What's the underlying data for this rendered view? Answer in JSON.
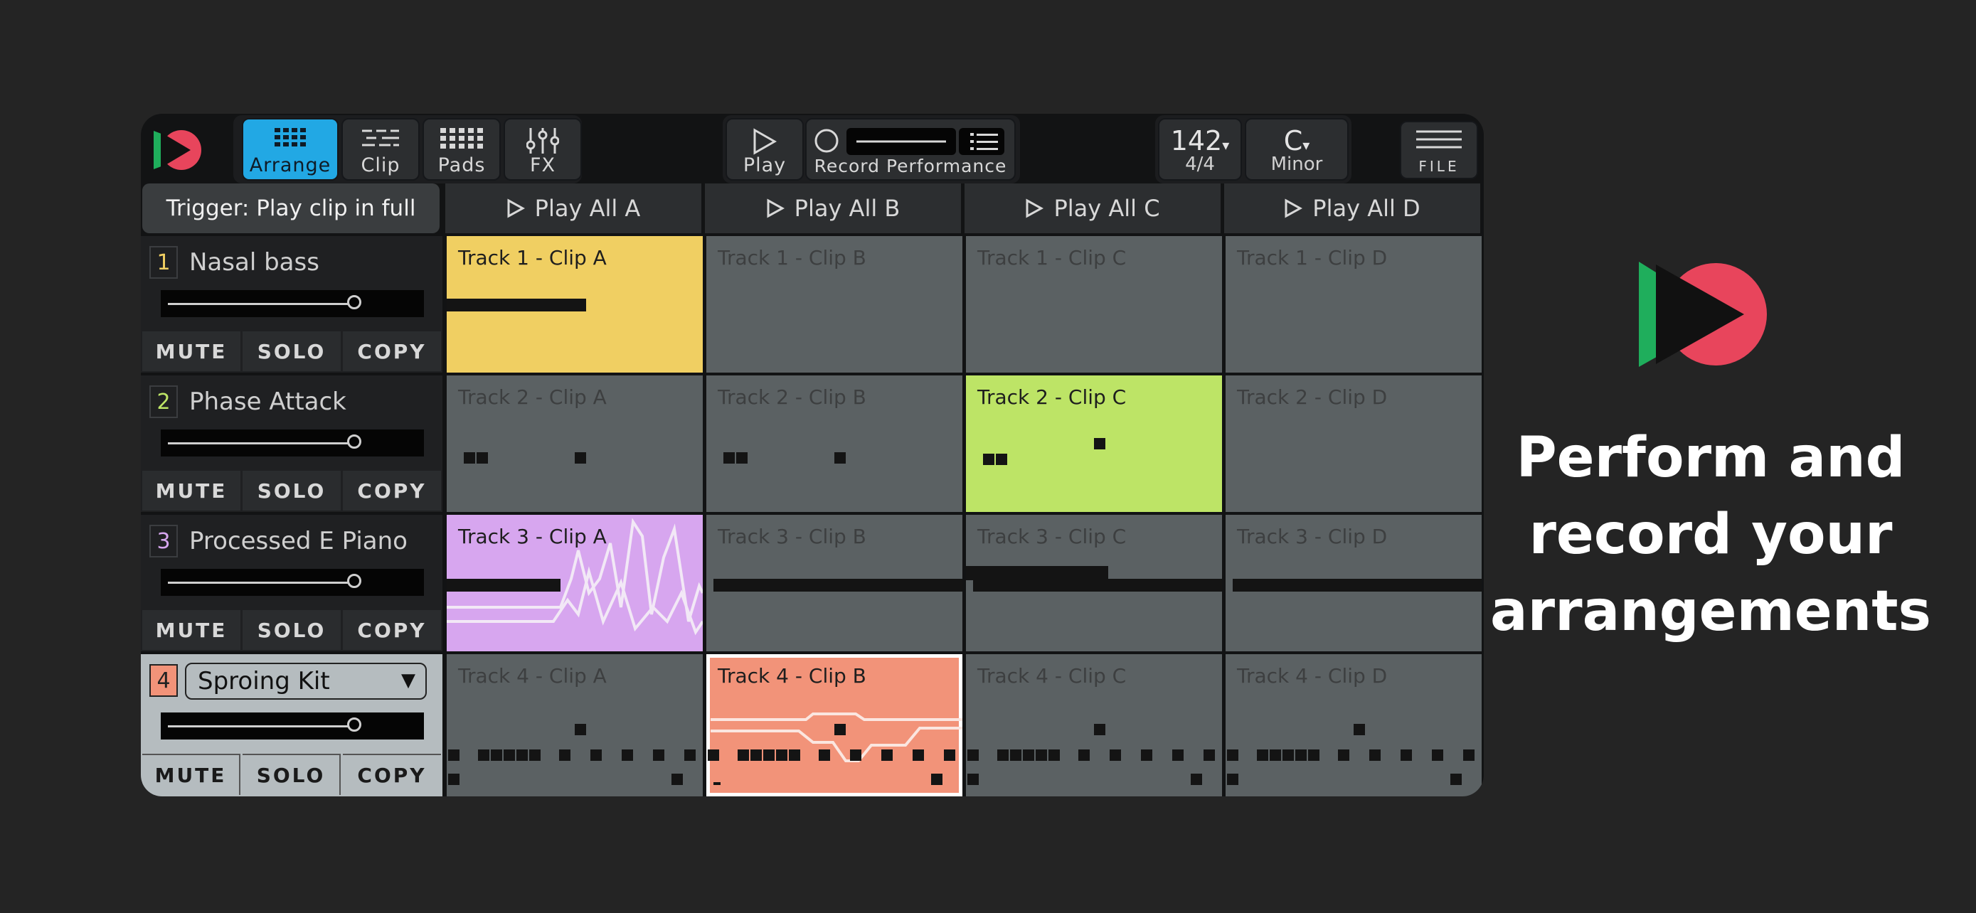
{
  "toolbar": {
    "tabs": [
      {
        "label": "Arrange",
        "icon": "grid-icon",
        "active": true
      },
      {
        "label": "Clip",
        "icon": "piano-roll-icon",
        "active": false
      },
      {
        "label": "Pads",
        "icon": "pads-icon",
        "active": false
      },
      {
        "label": "FX",
        "icon": "sliders-icon",
        "active": false
      }
    ],
    "play_label": "Play",
    "record_label": "Record Performance",
    "tempo": "142",
    "time_signature": "4/4",
    "key": "C",
    "scale": "Minor",
    "file_label": "FILE"
  },
  "trigger_label": "Trigger: Play clip in full",
  "play_all": [
    "Play All A",
    "Play All B",
    "Play All C",
    "Play All D"
  ],
  "tracks": [
    {
      "number": "1",
      "name": "Nasal bass",
      "volume": 0.82,
      "color": "#f0cf62"
    },
    {
      "number": "2",
      "name": "Phase Attack",
      "volume": 0.82,
      "color": "#bde466"
    },
    {
      "number": "3",
      "name": "Processed E Piano",
      "volume": 0.82,
      "color": "#d7a6ef"
    },
    {
      "number": "4",
      "name": "Sproing Kit",
      "volume": 0.82,
      "color": "#f29379",
      "selected": true
    }
  ],
  "track_buttons": {
    "mute": "MUTE",
    "solo": "SOLO",
    "copy": "COPY"
  },
  "clips": [
    [
      "Track 1 - Clip A",
      "Track 1 - Clip B",
      "Track 1 - Clip C",
      "Track 1 - Clip D"
    ],
    [
      "Track 2 - Clip A",
      "Track 2 - Clip B",
      "Track 2 - Clip C",
      "Track 2 - Clip D"
    ],
    [
      "Track 3 - Clip A",
      "Track 3 - Clip B",
      "Track 3 - Clip C",
      "Track 3 - Clip D"
    ],
    [
      "Track 4 - Clip A",
      "Track 4 - Clip B",
      "Track 4 - Clip C",
      "Track 4 - Clip D"
    ]
  ],
  "playing_clips": {
    "track1": "A",
    "track2": "C",
    "track3": "A",
    "track4": "B"
  },
  "colors": {
    "accent": "#22a8e4",
    "clip_idle": "#5b6163",
    "background": "#242424"
  },
  "promo": {
    "line1": "Perform and",
    "line2": "record your",
    "line3": "arrangements"
  }
}
